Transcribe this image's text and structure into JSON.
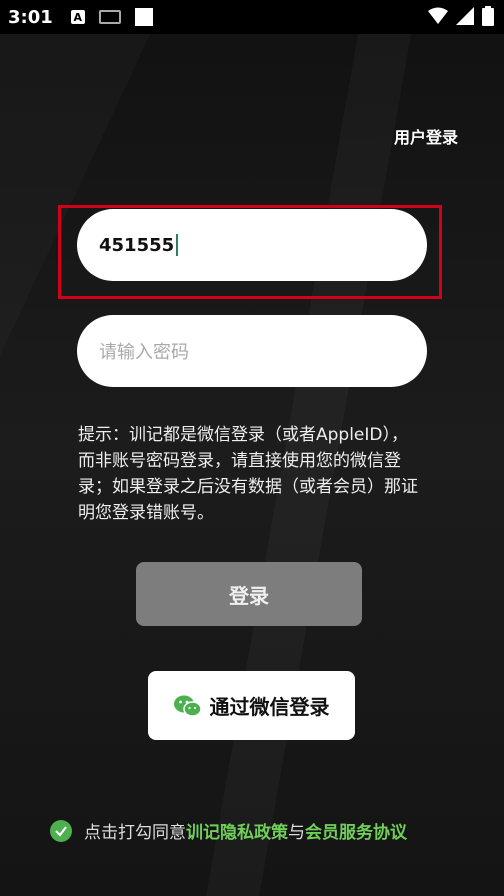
{
  "status_bar": {
    "time": "3:01",
    "icons": [
      "a-icon",
      "keyboard-icon",
      "square-icon",
      "wifi-icon",
      "signal-icon",
      "battery-icon"
    ]
  },
  "header": {
    "title": "用户登录"
  },
  "form": {
    "account_value": "451555",
    "password_placeholder": "请输入密码"
  },
  "hint": {
    "text": "提示：训记都是微信登录（或者AppleID），而非账号密码登录，请直接使用您的微信登录；如果登录之后没有数据（或者会员）那证明您登录错账号。"
  },
  "buttons": {
    "login_label": "登录",
    "wechat_label": "通过微信登录"
  },
  "agreement": {
    "prefix": "点击打勾同意",
    "privacy_link": "训记隐私政策",
    "joiner": "与",
    "service_link": "会员服务协议"
  },
  "colors": {
    "accent_green": "#6fcf58",
    "highlight_red": "#d0021b",
    "login_button_bg": "#7d7d7d"
  }
}
